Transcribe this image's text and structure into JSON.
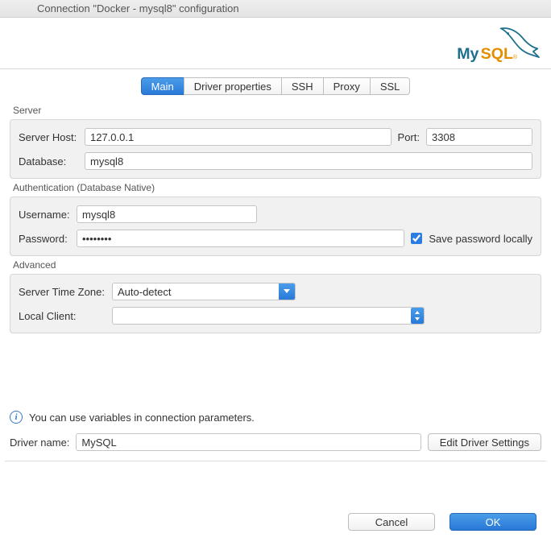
{
  "window": {
    "title": "Connection \"Docker - mysql8\" configuration"
  },
  "tabs": {
    "main": "Main",
    "driver_properties": "Driver properties",
    "ssh": "SSH",
    "proxy": "Proxy",
    "ssl": "SSL"
  },
  "sections": {
    "server": "Server",
    "auth": "Authentication (Database Native)",
    "advanced": "Advanced"
  },
  "server": {
    "host_label": "Server Host:",
    "host_value": "127.0.0.1",
    "port_label": "Port:",
    "port_value": "3308",
    "database_label": "Database:",
    "database_value": "mysql8"
  },
  "auth": {
    "username_label": "Username:",
    "username_value": "mysql8",
    "password_label": "Password:",
    "password_value": "••••••••",
    "save_label": "Save password locally",
    "save_checked": true
  },
  "advanced": {
    "tz_label": "Server Time Zone:",
    "tz_value": "Auto-detect",
    "local_client_label": "Local Client:",
    "local_client_value": ""
  },
  "info": {
    "text": "You can use variables in connection parameters."
  },
  "driver": {
    "name_label": "Driver name:",
    "name_value": "MySQL",
    "edit_button": "Edit Driver Settings"
  },
  "footer": {
    "cancel": "Cancel",
    "ok": "OK"
  },
  "logo": {
    "text": "MySQL"
  }
}
